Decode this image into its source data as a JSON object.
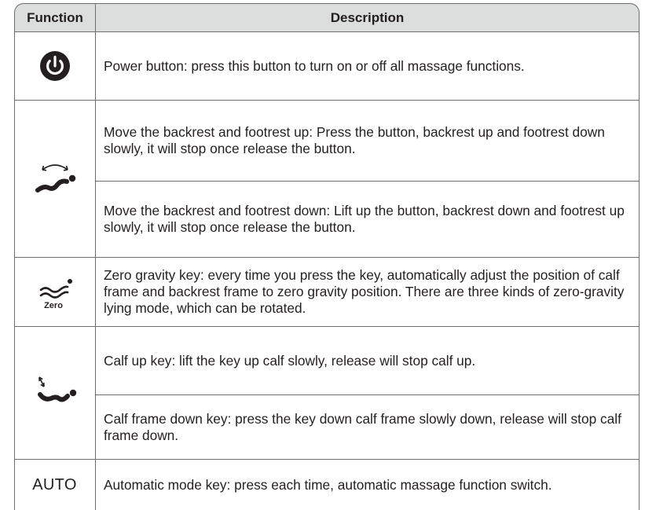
{
  "header": {
    "function_label": "Function",
    "description_label": "Description"
  },
  "rows": [
    {
      "icon": "power-icon",
      "description": "Power button: press this button to turn on or off all massage functions."
    },
    {
      "icon": "recline-backrest-icon",
      "description": "Move the backrest and footrest up: Press the button, backrest up and footrest down slowly, it will stop once release the button."
    },
    {
      "icon": "recline-backrest-icon",
      "description": "Move the backrest and footrest down: Lift up the button, backrest down and footrest up slowly, it will stop once release the button."
    },
    {
      "icon": "zero-gravity-icon",
      "icon_label": "Zero",
      "description": "Zero gravity key: every time you press the key, automatically adjust the position of calf frame and backrest frame to zero gravity position. There are three kinds of zero-gravity lying mode, which can be rotated."
    },
    {
      "icon": "calf-adjust-icon",
      "description": "Calf up key: lift the key up calf slowly, release will stop calf up."
    },
    {
      "icon": "calf-adjust-icon",
      "description": "Calf frame down key: press the key down calf frame slowly down, release will stop calf frame down."
    },
    {
      "icon": "auto-text-icon",
      "icon_label": "AUTO",
      "description": "Automatic mode key: press each time, automatic massage function switch."
    }
  ]
}
